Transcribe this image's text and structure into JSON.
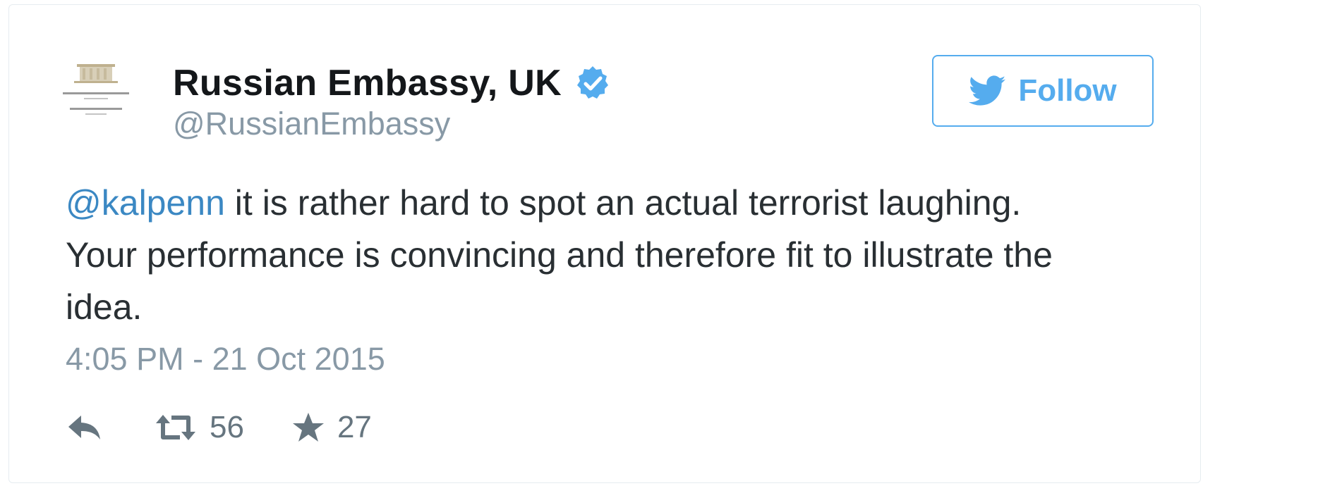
{
  "tweet": {
    "author": {
      "display_name": "Russian Embassy, UK",
      "handle": "@RussianEmbassy",
      "verified": true,
      "avatar_icon": "embassy-logo-icon"
    },
    "follow_button": {
      "label": "Follow",
      "icon": "twitter-bird-icon",
      "color": "#55acee"
    },
    "text": {
      "mention": "@kalpenn",
      "line1_rest": " it is rather hard to spot an actual terrorist laughing.",
      "line2": "Your performance is convincing and therefore fit to illustrate the",
      "line3": "idea."
    },
    "timestamp": "4:05 PM - 21 Oct 2015",
    "actions": {
      "reply_icon": "reply-icon",
      "retweet_icon": "retweet-icon",
      "retweet_count": "56",
      "favorite_icon": "star-icon",
      "favorite_count": "27"
    },
    "colors": {
      "link": "#3b88c3",
      "text": "#292f33",
      "muted": "#8899a6",
      "accent": "#55acee"
    }
  }
}
